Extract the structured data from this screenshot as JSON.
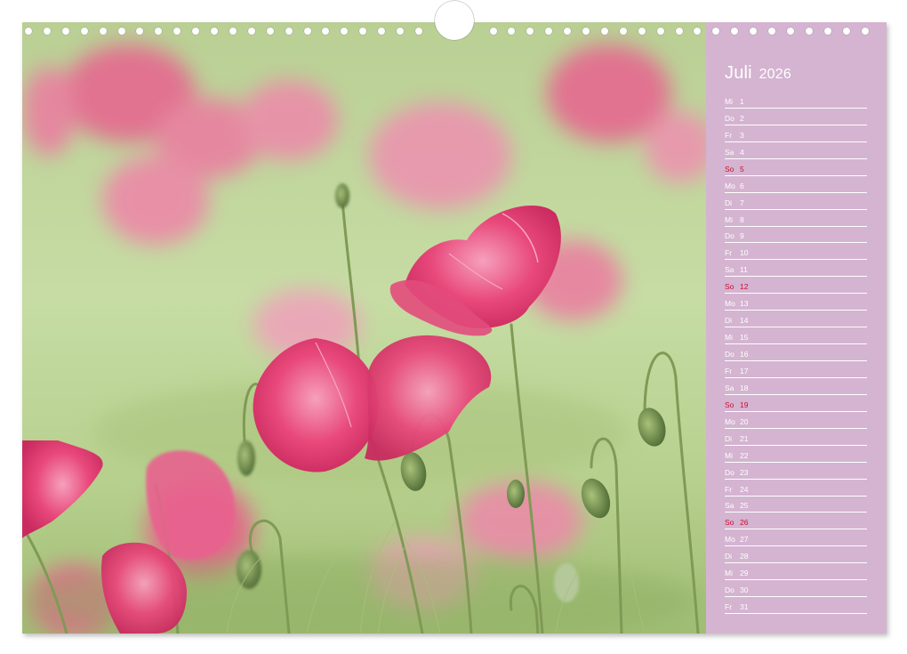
{
  "calendar": {
    "month": "Juli",
    "year": "2026",
    "days": [
      {
        "weekday": "Mi",
        "day": "1",
        "sunday": false
      },
      {
        "weekday": "Do",
        "day": "2",
        "sunday": false
      },
      {
        "weekday": "Fr",
        "day": "3",
        "sunday": false
      },
      {
        "weekday": "Sa",
        "day": "4",
        "sunday": false
      },
      {
        "weekday": "So",
        "day": "5",
        "sunday": true
      },
      {
        "weekday": "Mo",
        "day": "6",
        "sunday": false
      },
      {
        "weekday": "Di",
        "day": "7",
        "sunday": false
      },
      {
        "weekday": "Mi",
        "day": "8",
        "sunday": false
      },
      {
        "weekday": "Do",
        "day": "9",
        "sunday": false
      },
      {
        "weekday": "Fr",
        "day": "10",
        "sunday": false
      },
      {
        "weekday": "Sa",
        "day": "11",
        "sunday": false
      },
      {
        "weekday": "So",
        "day": "12",
        "sunday": true
      },
      {
        "weekday": "Mo",
        "day": "13",
        "sunday": false
      },
      {
        "weekday": "Di",
        "day": "14",
        "sunday": false
      },
      {
        "weekday": "Mi",
        "day": "15",
        "sunday": false
      },
      {
        "weekday": "Do",
        "day": "16",
        "sunday": false
      },
      {
        "weekday": "Fr",
        "day": "17",
        "sunday": false
      },
      {
        "weekday": "Sa",
        "day": "18",
        "sunday": false
      },
      {
        "weekday": "So",
        "day": "19",
        "sunday": true
      },
      {
        "weekday": "Mo",
        "day": "20",
        "sunday": false
      },
      {
        "weekday": "Di",
        "day": "21",
        "sunday": false
      },
      {
        "weekday": "Mi",
        "day": "22",
        "sunday": false
      },
      {
        "weekday": "Do",
        "day": "23",
        "sunday": false
      },
      {
        "weekday": "Fr",
        "day": "24",
        "sunday": false
      },
      {
        "weekday": "Sa",
        "day": "25",
        "sunday": false
      },
      {
        "weekday": "So",
        "day": "26",
        "sunday": true
      },
      {
        "weekday": "Mo",
        "day": "27",
        "sunday": false
      },
      {
        "weekday": "Di",
        "day": "28",
        "sunday": false
      },
      {
        "weekday": "Mi",
        "day": "29",
        "sunday": false
      },
      {
        "weekday": "Do",
        "day": "30",
        "sunday": false
      },
      {
        "weekday": "Fr",
        "day": "31",
        "sunday": false
      }
    ]
  },
  "colors": {
    "panel": "#d4b4d1",
    "sunday": "#c8102e",
    "poppy": "#e8487a",
    "stem": "#7f9a55"
  },
  "photo": {
    "subject": "poppy-field-photo"
  }
}
